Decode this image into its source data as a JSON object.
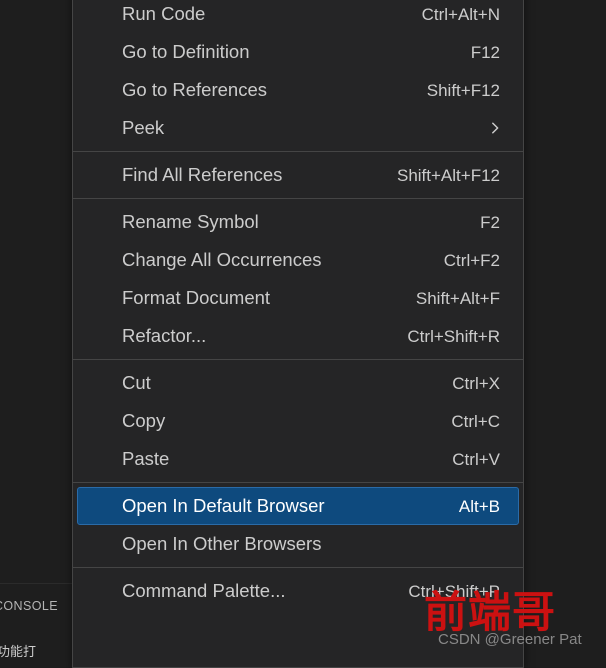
{
  "editor": {
    "background_color": "#1e1e1e",
    "panel": {
      "tabs": [
        {
          "label": "CONSOLE"
        }
      ],
      "body_text": "功能打"
    }
  },
  "context_menu": {
    "background_color": "#252526",
    "border_color": "#454545",
    "selected_background_color": "#0e4a7e",
    "selected_border_color": "#2a6ba8",
    "groups": [
      {
        "items": [
          {
            "label": "Run Code",
            "shortcut": "Ctrl+Alt+N",
            "selected": false,
            "submenu": false
          },
          {
            "label": "Go to Definition",
            "shortcut": "F12",
            "selected": false,
            "submenu": false
          },
          {
            "label": "Go to References",
            "shortcut": "Shift+F12",
            "selected": false,
            "submenu": false
          },
          {
            "label": "Peek",
            "shortcut": "",
            "selected": false,
            "submenu": true
          }
        ]
      },
      {
        "items": [
          {
            "label": "Find All References",
            "shortcut": "Shift+Alt+F12",
            "selected": false,
            "submenu": false
          }
        ]
      },
      {
        "items": [
          {
            "label": "Rename Symbol",
            "shortcut": "F2",
            "selected": false,
            "submenu": false
          },
          {
            "label": "Change All Occurrences",
            "shortcut": "Ctrl+F2",
            "selected": false,
            "submenu": false
          },
          {
            "label": "Format Document",
            "shortcut": "Shift+Alt+F",
            "selected": false,
            "submenu": false
          },
          {
            "label": "Refactor...",
            "shortcut": "Ctrl+Shift+R",
            "selected": false,
            "submenu": false
          }
        ]
      },
      {
        "items": [
          {
            "label": "Cut",
            "shortcut": "Ctrl+X",
            "selected": false,
            "submenu": false
          },
          {
            "label": "Copy",
            "shortcut": "Ctrl+C",
            "selected": false,
            "submenu": false
          },
          {
            "label": "Paste",
            "shortcut": "Ctrl+V",
            "selected": false,
            "submenu": false
          }
        ]
      },
      {
        "items": [
          {
            "label": "Open In Default Browser",
            "shortcut": "Alt+B",
            "selected": true,
            "submenu": false
          },
          {
            "label": "Open In Other Browsers",
            "shortcut": "",
            "selected": false,
            "submenu": false
          }
        ]
      },
      {
        "items": [
          {
            "label": "Command Palette...",
            "shortcut": "Ctrl+Shift+P",
            "selected": false,
            "submenu": false
          }
        ]
      }
    ]
  },
  "watermark": {
    "text_cn": "前端哥",
    "text_credit": "CSDN @Greener Pat",
    "color_cn": "#cc1111",
    "color_credit": "#9a9a9a"
  }
}
